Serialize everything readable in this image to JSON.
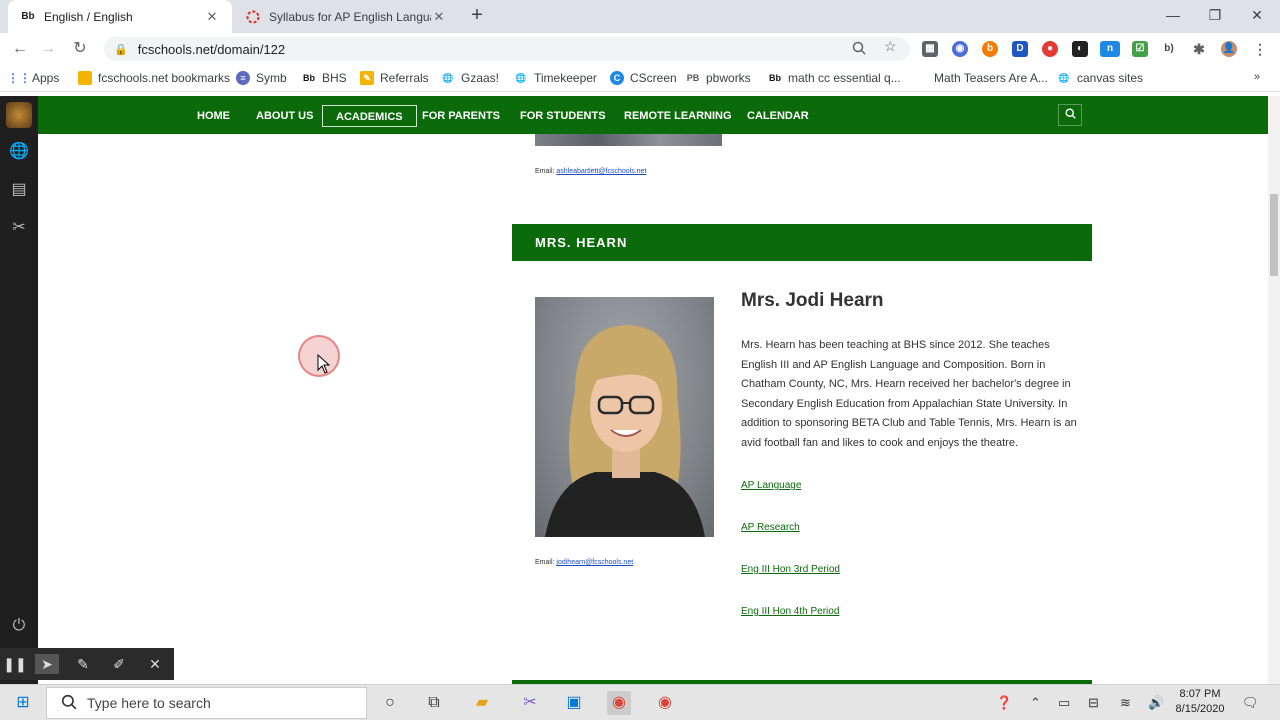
{
  "browser": {
    "tabs": [
      {
        "favicon": "Bb",
        "title": "English / English",
        "active": true
      },
      {
        "favicon": "spinner",
        "title": "Syllabus for AP English Language",
        "active": false
      }
    ],
    "url": "fcschools.net/domain/122"
  },
  "bookmarks": [
    {
      "label": "Apps",
      "icon": "apps-grid-icon"
    },
    {
      "label": "fcschools.net bookmarks",
      "icon": "folder-icon"
    },
    {
      "label": "Symb",
      "icon": "symb-icon"
    },
    {
      "label": "BHS",
      "icon": "Bb"
    },
    {
      "label": "Referrals",
      "icon": "referrals-icon"
    },
    {
      "label": "Gzaas!",
      "icon": "globe-icon"
    },
    {
      "label": "Timekeeper",
      "icon": "globe-icon"
    },
    {
      "label": "CScreen",
      "icon": "cscreen-icon"
    },
    {
      "label": "pbworks",
      "icon": "PB"
    },
    {
      "label": "math cc essential q...",
      "icon": "Bb"
    },
    {
      "label": "Math Teasers Are A...",
      "icon": ""
    },
    {
      "label": "canvas sites",
      "icon": "globe-icon"
    }
  ],
  "site_nav": {
    "items": [
      "HOME",
      "ABOUT US",
      "ACADEMICS",
      "FOR PARENTS",
      "FOR STUDENTS",
      "REMOTE LEARNING",
      "CALENDAR"
    ],
    "selected": "ACADEMICS"
  },
  "previous_teacher": {
    "email_label": "Email:",
    "email": "ashleabartlett@fcschools.net"
  },
  "teacher": {
    "section_title": "MRS. HEARN",
    "name": "Mrs. Jodi Hearn",
    "bio": "Mrs. Hearn has been teaching at BHS since 2012.  She teaches English III and AP English Language and Composition. Born in Chatham County, NC, Mrs. Hearn received her bachelor's degree in Secondary English Education from Appalachian State University.  In addition to sponsoring BETA Club and Table Tennis, Mrs. Hearn is an avid football fan and likes to cook and enjoys the theatre.",
    "email_label": "Email:",
    "email": "jodihearn@fcschools.net",
    "links": [
      "AP Language",
      "AP Research",
      "Eng III Hon 3rd Period",
      "Eng III Hon 4th Period"
    ]
  },
  "taskbar": {
    "search_placeholder": "Type here to search",
    "time": "8:07 PM",
    "date": "8/15/2020"
  },
  "colors": {
    "school_green": "#0b6b0b",
    "rail_dark": "#1f1f1f"
  }
}
